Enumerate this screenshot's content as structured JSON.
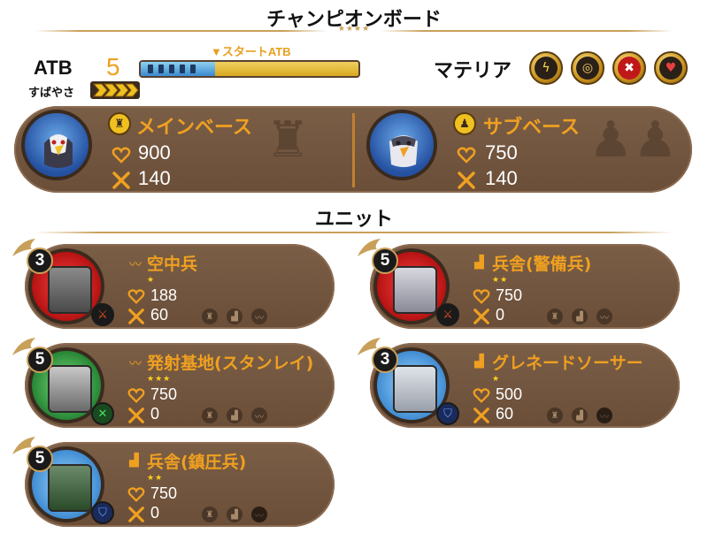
{
  "header": {
    "title": "チャンピオンボード",
    "stars": "★★★★"
  },
  "atb": {
    "label": "ATB",
    "speed_label": "すばやさ",
    "value": "5",
    "start_label": "▼スタートATB",
    "fill_fraction": 0.34
  },
  "materia": {
    "label": "マテリア",
    "slots": [
      {
        "icon": "lightning-icon",
        "symbol": "ϟ"
      },
      {
        "icon": "swirl-icon",
        "symbol": "◎"
      },
      {
        "icon": "cross-icon",
        "symbol": "✖"
      },
      {
        "icon": "heart-icon",
        "symbol": "♥"
      }
    ]
  },
  "bases": [
    {
      "role_icon": "rook-icon",
      "role_symbol": "♜",
      "title": "メインベース",
      "hp": "900",
      "atk": "140"
    },
    {
      "role_icon": "pawn-icon",
      "role_symbol": "♟",
      "title": "サブベース",
      "hp": "750",
      "atk": "140"
    }
  ],
  "units_title": "ユニット",
  "units": [
    {
      "cost": "3",
      "name": "空中兵",
      "type_symbol": "〰",
      "stars": "★",
      "hp": "188",
      "atk": "60",
      "badge": "sword",
      "portrait": "red"
    },
    {
      "cost": "5",
      "name": "兵舎(警備兵)",
      "type_symbol": "▟",
      "stars": "★★",
      "hp": "750",
      "atk": "0",
      "badge": "sword",
      "portrait": "red"
    },
    {
      "cost": "5",
      "name": "発射基地(スタンレイ)",
      "type_symbol": "〰",
      "stars": "★★★",
      "hp": "750",
      "atk": "0",
      "badge": "x",
      "portrait": "green"
    },
    {
      "cost": "3",
      "name": "グレネードソーサー",
      "type_symbol": "▟",
      "stars": "★",
      "hp": "500",
      "atk": "60",
      "badge": "shield",
      "portrait": "blue"
    },
    {
      "cost": "5",
      "name": "兵舎(鎮圧兵)",
      "type_symbol": "▟",
      "stars": "★★",
      "hp": "750",
      "atk": "0",
      "badge": "shield",
      "portrait": "blue"
    }
  ],
  "colors": {
    "accent": "#f0a020",
    "panel": "#6a4e38",
    "gold": "#c9a05a"
  }
}
